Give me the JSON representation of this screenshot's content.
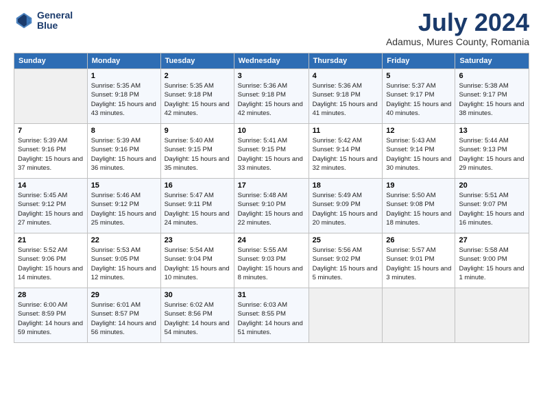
{
  "header": {
    "logo_line1": "General",
    "logo_line2": "Blue",
    "month": "July 2024",
    "location": "Adamus, Mures County, Romania"
  },
  "days_of_week": [
    "Sunday",
    "Monday",
    "Tuesday",
    "Wednesday",
    "Thursday",
    "Friday",
    "Saturday"
  ],
  "weeks": [
    [
      {
        "day": "",
        "sunrise": "",
        "sunset": "",
        "daylight": ""
      },
      {
        "day": "1",
        "sunrise": "Sunrise: 5:35 AM",
        "sunset": "Sunset: 9:18 PM",
        "daylight": "Daylight: 15 hours and 43 minutes."
      },
      {
        "day": "2",
        "sunrise": "Sunrise: 5:35 AM",
        "sunset": "Sunset: 9:18 PM",
        "daylight": "Daylight: 15 hours and 42 minutes."
      },
      {
        "day": "3",
        "sunrise": "Sunrise: 5:36 AM",
        "sunset": "Sunset: 9:18 PM",
        "daylight": "Daylight: 15 hours and 42 minutes."
      },
      {
        "day": "4",
        "sunrise": "Sunrise: 5:36 AM",
        "sunset": "Sunset: 9:18 PM",
        "daylight": "Daylight: 15 hours and 41 minutes."
      },
      {
        "day": "5",
        "sunrise": "Sunrise: 5:37 AM",
        "sunset": "Sunset: 9:17 PM",
        "daylight": "Daylight: 15 hours and 40 minutes."
      },
      {
        "day": "6",
        "sunrise": "Sunrise: 5:38 AM",
        "sunset": "Sunset: 9:17 PM",
        "daylight": "Daylight: 15 hours and 38 minutes."
      }
    ],
    [
      {
        "day": "7",
        "sunrise": "Sunrise: 5:39 AM",
        "sunset": "Sunset: 9:16 PM",
        "daylight": "Daylight: 15 hours and 37 minutes."
      },
      {
        "day": "8",
        "sunrise": "Sunrise: 5:39 AM",
        "sunset": "Sunset: 9:16 PM",
        "daylight": "Daylight: 15 hours and 36 minutes."
      },
      {
        "day": "9",
        "sunrise": "Sunrise: 5:40 AM",
        "sunset": "Sunset: 9:15 PM",
        "daylight": "Daylight: 15 hours and 35 minutes."
      },
      {
        "day": "10",
        "sunrise": "Sunrise: 5:41 AM",
        "sunset": "Sunset: 9:15 PM",
        "daylight": "Daylight: 15 hours and 33 minutes."
      },
      {
        "day": "11",
        "sunrise": "Sunrise: 5:42 AM",
        "sunset": "Sunset: 9:14 PM",
        "daylight": "Daylight: 15 hours and 32 minutes."
      },
      {
        "day": "12",
        "sunrise": "Sunrise: 5:43 AM",
        "sunset": "Sunset: 9:14 PM",
        "daylight": "Daylight: 15 hours and 30 minutes."
      },
      {
        "day": "13",
        "sunrise": "Sunrise: 5:44 AM",
        "sunset": "Sunset: 9:13 PM",
        "daylight": "Daylight: 15 hours and 29 minutes."
      }
    ],
    [
      {
        "day": "14",
        "sunrise": "Sunrise: 5:45 AM",
        "sunset": "Sunset: 9:12 PM",
        "daylight": "Daylight: 15 hours and 27 minutes."
      },
      {
        "day": "15",
        "sunrise": "Sunrise: 5:46 AM",
        "sunset": "Sunset: 9:12 PM",
        "daylight": "Daylight: 15 hours and 25 minutes."
      },
      {
        "day": "16",
        "sunrise": "Sunrise: 5:47 AM",
        "sunset": "Sunset: 9:11 PM",
        "daylight": "Daylight: 15 hours and 24 minutes."
      },
      {
        "day": "17",
        "sunrise": "Sunrise: 5:48 AM",
        "sunset": "Sunset: 9:10 PM",
        "daylight": "Daylight: 15 hours and 22 minutes."
      },
      {
        "day": "18",
        "sunrise": "Sunrise: 5:49 AM",
        "sunset": "Sunset: 9:09 PM",
        "daylight": "Daylight: 15 hours and 20 minutes."
      },
      {
        "day": "19",
        "sunrise": "Sunrise: 5:50 AM",
        "sunset": "Sunset: 9:08 PM",
        "daylight": "Daylight: 15 hours and 18 minutes."
      },
      {
        "day": "20",
        "sunrise": "Sunrise: 5:51 AM",
        "sunset": "Sunset: 9:07 PM",
        "daylight": "Daylight: 15 hours and 16 minutes."
      }
    ],
    [
      {
        "day": "21",
        "sunrise": "Sunrise: 5:52 AM",
        "sunset": "Sunset: 9:06 PM",
        "daylight": "Daylight: 15 hours and 14 minutes."
      },
      {
        "day": "22",
        "sunrise": "Sunrise: 5:53 AM",
        "sunset": "Sunset: 9:05 PM",
        "daylight": "Daylight: 15 hours and 12 minutes."
      },
      {
        "day": "23",
        "sunrise": "Sunrise: 5:54 AM",
        "sunset": "Sunset: 9:04 PM",
        "daylight": "Daylight: 15 hours and 10 minutes."
      },
      {
        "day": "24",
        "sunrise": "Sunrise: 5:55 AM",
        "sunset": "Sunset: 9:03 PM",
        "daylight": "Daylight: 15 hours and 8 minutes."
      },
      {
        "day": "25",
        "sunrise": "Sunrise: 5:56 AM",
        "sunset": "Sunset: 9:02 PM",
        "daylight": "Daylight: 15 hours and 5 minutes."
      },
      {
        "day": "26",
        "sunrise": "Sunrise: 5:57 AM",
        "sunset": "Sunset: 9:01 PM",
        "daylight": "Daylight: 15 hours and 3 minutes."
      },
      {
        "day": "27",
        "sunrise": "Sunrise: 5:58 AM",
        "sunset": "Sunset: 9:00 PM",
        "daylight": "Daylight: 15 hours and 1 minute."
      }
    ],
    [
      {
        "day": "28",
        "sunrise": "Sunrise: 6:00 AM",
        "sunset": "Sunset: 8:59 PM",
        "daylight": "Daylight: 14 hours and 59 minutes."
      },
      {
        "day": "29",
        "sunrise": "Sunrise: 6:01 AM",
        "sunset": "Sunset: 8:57 PM",
        "daylight": "Daylight: 14 hours and 56 minutes."
      },
      {
        "day": "30",
        "sunrise": "Sunrise: 6:02 AM",
        "sunset": "Sunset: 8:56 PM",
        "daylight": "Daylight: 14 hours and 54 minutes."
      },
      {
        "day": "31",
        "sunrise": "Sunrise: 6:03 AM",
        "sunset": "Sunset: 8:55 PM",
        "daylight": "Daylight: 14 hours and 51 minutes."
      },
      {
        "day": "",
        "sunrise": "",
        "sunset": "",
        "daylight": ""
      },
      {
        "day": "",
        "sunrise": "",
        "sunset": "",
        "daylight": ""
      },
      {
        "day": "",
        "sunrise": "",
        "sunset": "",
        "daylight": ""
      }
    ]
  ]
}
